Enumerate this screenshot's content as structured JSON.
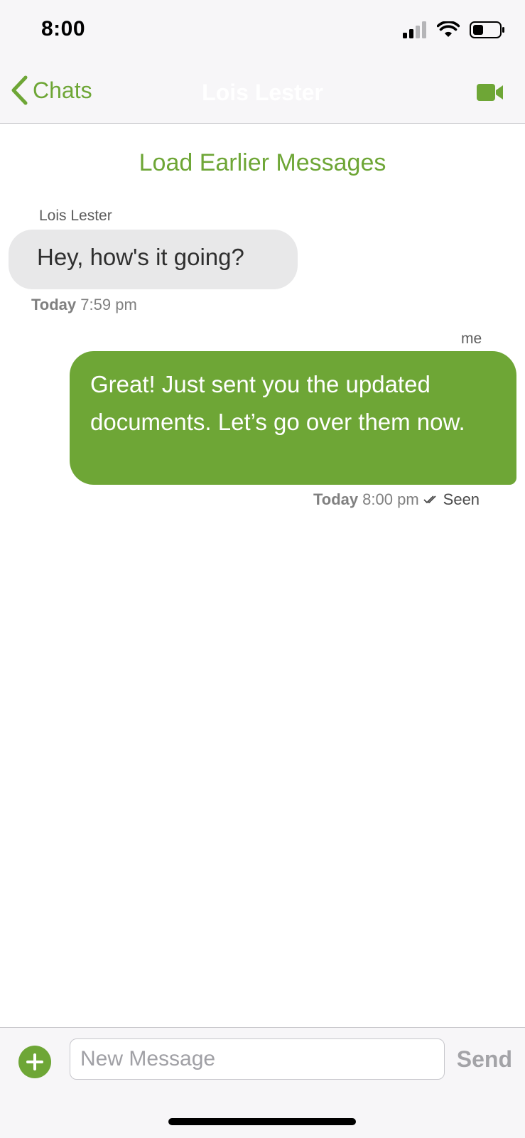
{
  "status_bar": {
    "time": "8:00",
    "icons": [
      "cellular-signal-icon",
      "wifi-icon",
      "battery-icon"
    ]
  },
  "nav": {
    "back_label": "Chats",
    "title": "Lois Lester",
    "action_icon": "video-camera-icon"
  },
  "chat": {
    "load_earlier_label": "Load Earlier Messages",
    "messages": [
      {
        "sender": "Lois Lester",
        "text": "Hey, how's it going?",
        "day": "Today",
        "time": "7:59 pm",
        "direction": "incoming"
      },
      {
        "sender": "me",
        "text": "Great! Just sent you the updated documents. Let’s go over them now.",
        "day": "Today",
        "time": "8:00 pm",
        "status": "Seen",
        "direction": "outgoing"
      }
    ]
  },
  "composer": {
    "placeholder": "New Message",
    "send_label": "Send",
    "add_icon": "plus-circle-icon"
  },
  "colors": {
    "accent": "#6ea636",
    "incoming_bubble": "#e8e8e9",
    "bar_background": "#f7f6f8"
  }
}
